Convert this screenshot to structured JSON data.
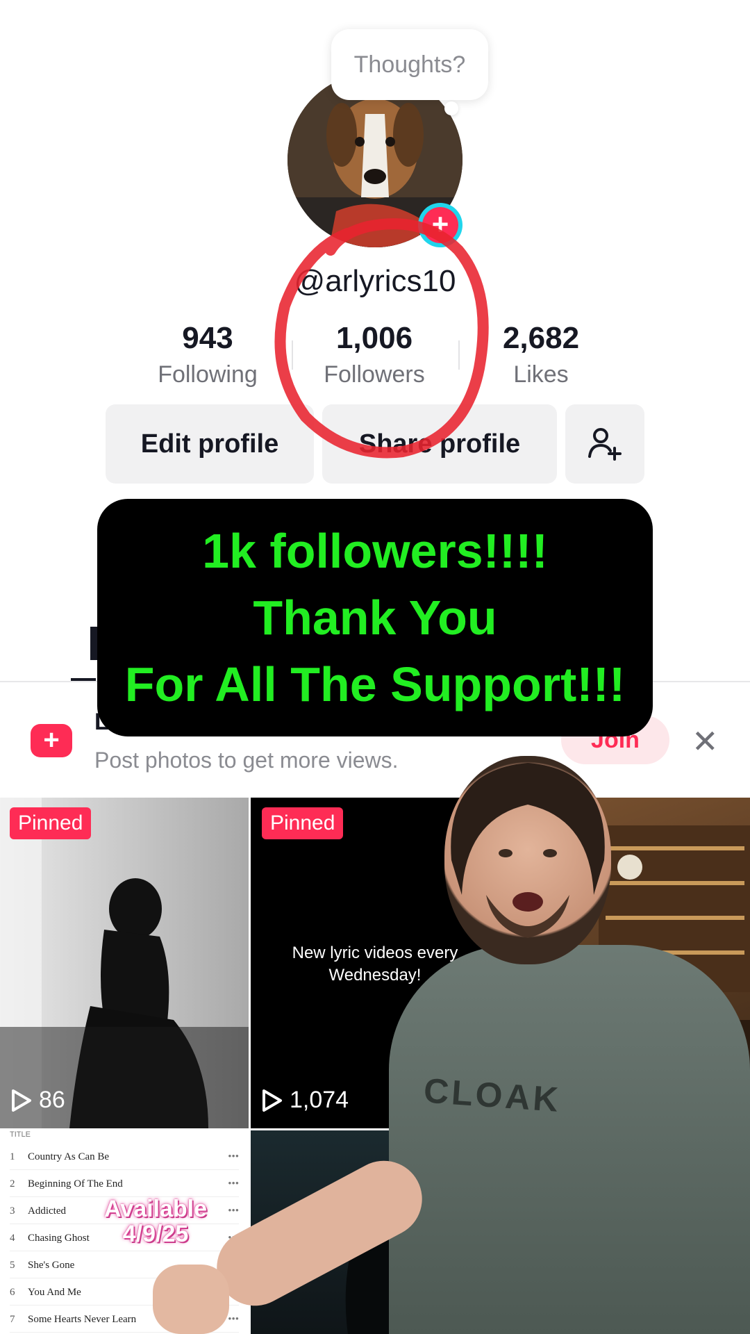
{
  "bubble": {
    "text": "Thoughts?"
  },
  "profile": {
    "username": "@arlyrics10",
    "stats": [
      {
        "value": "943",
        "label": "Following"
      },
      {
        "value": "1,006",
        "label": "Followers"
      },
      {
        "value": "2,682",
        "label": "Likes"
      }
    ]
  },
  "buttons": {
    "edit": "Edit profile",
    "share": "Share profile"
  },
  "caption": {
    "lines": [
      "1k followers!!!!",
      "Thank You",
      "For All The Support!!!"
    ]
  },
  "banner": {
    "title_stub": "Lo",
    "subtitle": "Post photos to get more views.",
    "join": "Join"
  },
  "grid": [
    {
      "badge": "Pinned",
      "views": "86"
    },
    {
      "badge": "Pinned",
      "views": "1,074",
      "text": "New lyric videos every Wednesday!"
    }
  ],
  "songlist": {
    "header": "TITLE",
    "rows": [
      {
        "n": "1",
        "title": "Country As Can Be"
      },
      {
        "n": "2",
        "title": "Beginning Of The End"
      },
      {
        "n": "3",
        "title": "Addicted"
      },
      {
        "n": "4",
        "title": "Chasing Ghost"
      },
      {
        "n": "5",
        "title": "She's Gone"
      },
      {
        "n": "6",
        "title": "You And Me"
      },
      {
        "n": "7",
        "title": "Some Hearts Never Learn"
      }
    ],
    "available": "Available",
    "date": "4/9/25"
  },
  "overlay": {
    "shirt_text": "CLOAK"
  },
  "colors": {
    "accent": "#fe2c55",
    "caption_text": "#22ee22",
    "circle": "#e8232f"
  }
}
